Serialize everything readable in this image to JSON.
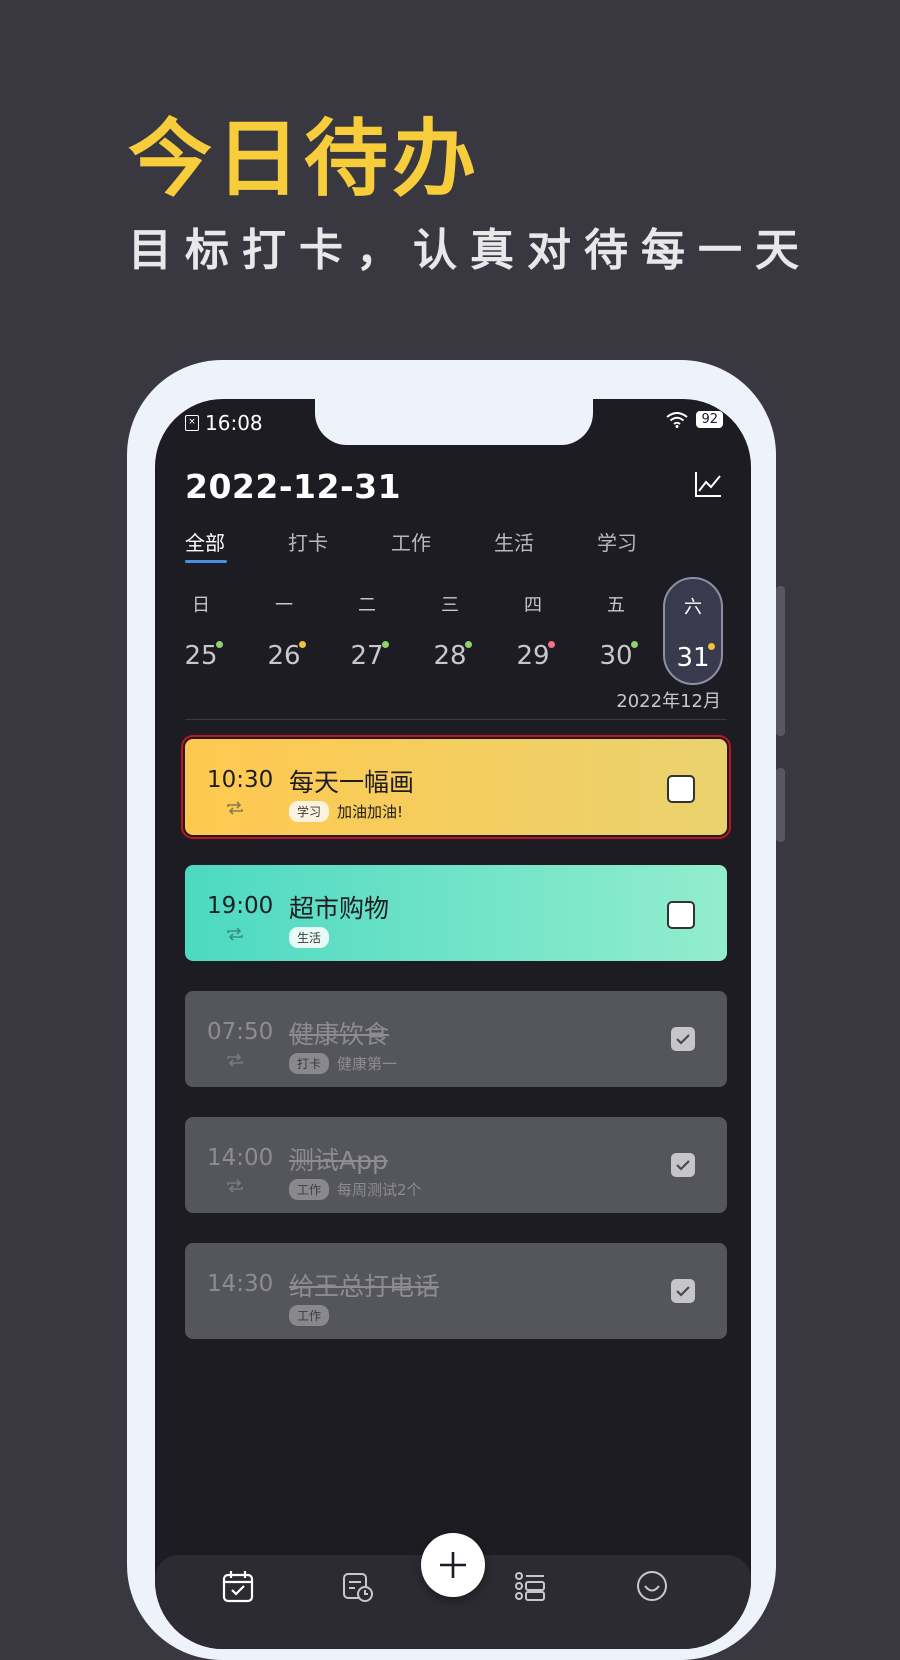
{
  "promo": {
    "title": "今日待办",
    "subtitle": "目标打卡，认真对待每一天"
  },
  "status_bar": {
    "time": "16:08",
    "battery": "92"
  },
  "header": {
    "date": "2022-12-31",
    "chart_icon": "chart-line-icon"
  },
  "tabs": [
    {
      "label": "全部",
      "active": true
    },
    {
      "label": "打卡",
      "active": false
    },
    {
      "label": "工作",
      "active": false
    },
    {
      "label": "生活",
      "active": false
    },
    {
      "label": "学习",
      "active": false
    }
  ],
  "week": [
    {
      "weekday": "日",
      "day": "25",
      "dot_color": "#8fd46a"
    },
    {
      "weekday": "一",
      "day": "26",
      "dot_color": "#f2c23a"
    },
    {
      "weekday": "二",
      "day": "27",
      "dot_color": "#8fd46a"
    },
    {
      "weekday": "三",
      "day": "28",
      "dot_color": "#8fd46a"
    },
    {
      "weekday": "四",
      "day": "29",
      "dot_color": "#f2708a"
    },
    {
      "weekday": "五",
      "day": "30",
      "dot_color": "#8fd46a"
    },
    {
      "weekday": "六",
      "day": "31",
      "dot_color": "#f2c23a",
      "selected": true
    }
  ],
  "month_label": "2022年12月",
  "tasks": [
    {
      "time": "10:30",
      "title": "每天一幅画",
      "tag": "学习",
      "note": "加油加油!",
      "done": false,
      "style": "yellow"
    },
    {
      "time": "19:00",
      "title": "超市购物",
      "tag": "生活",
      "note": "",
      "done": false,
      "style": "teal"
    },
    {
      "time": "07:50",
      "title": "健康饮食",
      "tag": "打卡",
      "note": "健康第一",
      "done": true
    },
    {
      "time": "14:00",
      "title": "测试App",
      "tag": "工作",
      "note": "每周测试2个",
      "done": true
    },
    {
      "time": "14:30",
      "title": "给王总打电话",
      "tag": "工作",
      "note": "",
      "done": true
    }
  ],
  "colors": {
    "accent_yellow": "#f7cd3b",
    "task_yellow_start": "#ffc94f",
    "task_yellow_end": "#ead26f",
    "task_teal_start": "#4cd9c2",
    "task_teal_end": "#93edcd",
    "tab_underline": "#4a90e2"
  },
  "bottom_nav": [
    "calendar-check-icon",
    "schedule-icon",
    "add-icon",
    "list-icon",
    "smile-icon"
  ]
}
